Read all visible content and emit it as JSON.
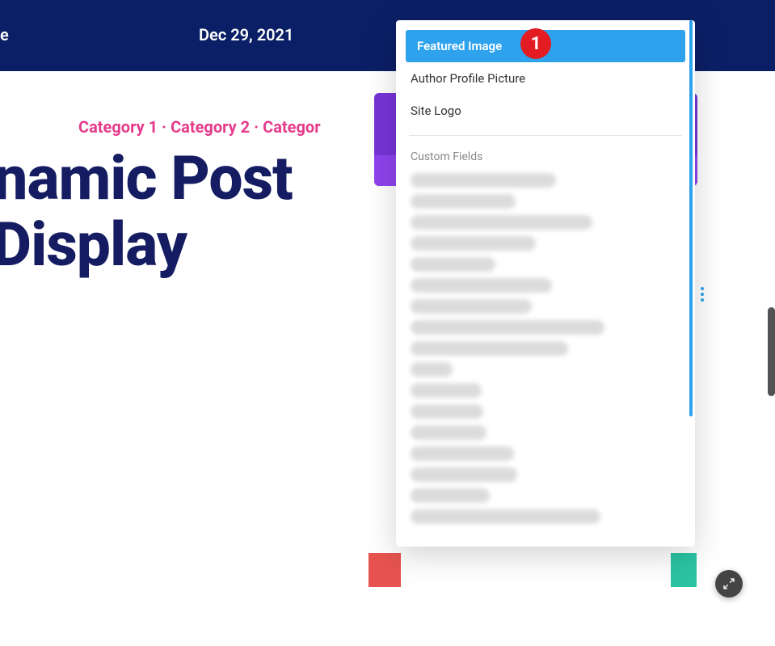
{
  "topbar": {
    "label_cut": "e",
    "date": "Dec 29, 2021"
  },
  "post": {
    "categories": "Category 1 · Category 2 · Categor",
    "title_line1": "ynamic Post",
    "title_line2": "ill Display"
  },
  "dropdown": {
    "items": [
      "Featured Image",
      "Author Profile Picture",
      "Site Logo"
    ],
    "section_label": "Custom Fields"
  },
  "annotation": {
    "step": "1"
  }
}
